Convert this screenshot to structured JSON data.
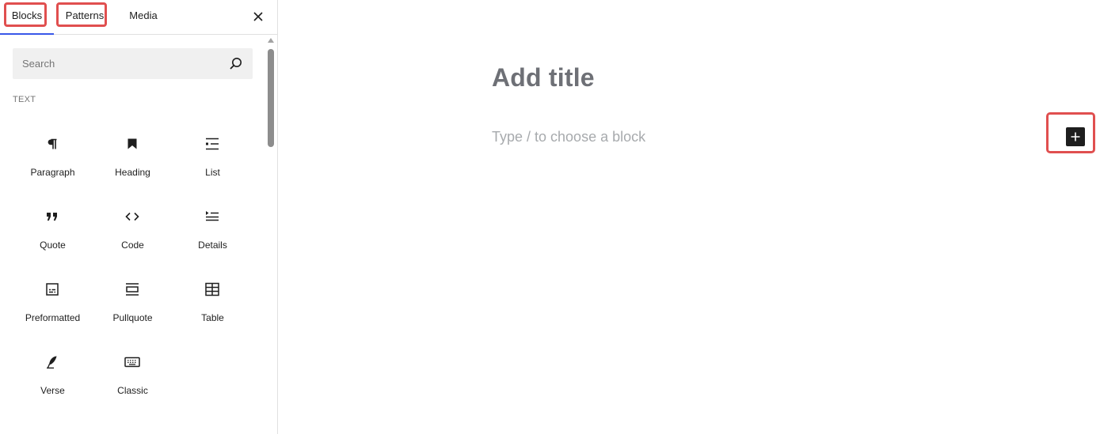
{
  "inserter": {
    "tabs": [
      {
        "label": "Blocks"
      },
      {
        "label": "Patterns"
      },
      {
        "label": "Media"
      }
    ],
    "search": {
      "placeholder": "Search"
    },
    "category": "TEXT",
    "blocks": [
      {
        "label": "Paragraph",
        "icon": "paragraph-icon"
      },
      {
        "label": "Heading",
        "icon": "heading-icon"
      },
      {
        "label": "List",
        "icon": "list-icon"
      },
      {
        "label": "Quote",
        "icon": "quote-icon"
      },
      {
        "label": "Code",
        "icon": "code-icon"
      },
      {
        "label": "Details",
        "icon": "details-icon"
      },
      {
        "label": "Preformatted",
        "icon": "preformatted-icon"
      },
      {
        "label": "Pullquote",
        "icon": "pullquote-icon"
      },
      {
        "label": "Table",
        "icon": "table-icon"
      },
      {
        "label": "Verse",
        "icon": "verse-icon"
      },
      {
        "label": "Classic",
        "icon": "classic-icon"
      }
    ]
  },
  "editor": {
    "title_placeholder": "Add title",
    "block_placeholder": "Type / to choose a block"
  },
  "colors": {
    "accent": "#3858e9",
    "highlight": "#e04f4f",
    "dark": "#1e1e1e"
  }
}
